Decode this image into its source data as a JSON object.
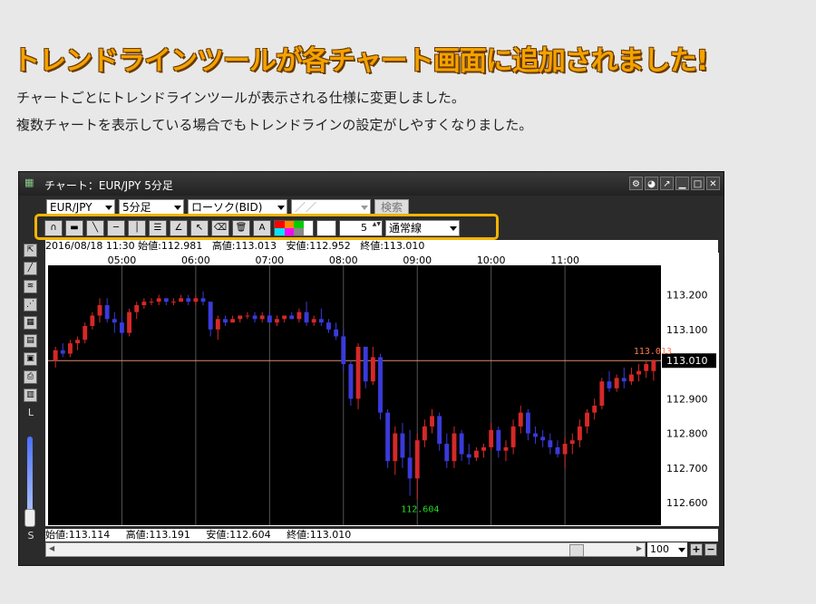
{
  "headline": "トレンドラインツールが各チャート画面に追加されました!",
  "description": [
    "チャートごとにトレンドラインツールが表示される仕様に変更しました。",
    "複数チャートを表示している場合でもトレンドラインの設定がしやすくなりました。"
  ],
  "window": {
    "title": "チャート：EUR/JPY 5分足",
    "buttons": [
      "gear-icon",
      "palette-icon",
      "popout-icon",
      "minimize-icon",
      "maximize-icon",
      "close-icon"
    ]
  },
  "toolbar": {
    "pair": "EUR/JPY",
    "timeframe": "5分足",
    "chart_type": "ローソク(BID)",
    "date_value": "／／",
    "search_label": "検索"
  },
  "trend_tools": {
    "line_width": "5",
    "line_style": "通常線",
    "palette_colors": [
      "#ff0000",
      "#ff8800",
      "#00cc00",
      "#ffffff",
      "#00e5ff",
      "#ff00ff",
      "#888888",
      "#ffffff"
    ]
  },
  "info_top": {
    "datetime": "2016/08/18 11:30",
    "open": "始値:112.981",
    "high": "高値:113.013",
    "low": "安値:112.952",
    "close": "終値:113.010"
  },
  "info_bottom": {
    "open": "始値:113.114",
    "high": "高値:113.191",
    "low": "安値:112.604",
    "close": "終値:113.010"
  },
  "side_tools": [
    "cursor-icon",
    "trendline-icon",
    "fib-icon",
    "channel-icon",
    "table-icon",
    "grid-icon",
    "note-icon",
    "print-icon",
    "save-icon"
  ],
  "zoom_labels": {
    "top": "L",
    "bottom": "S"
  },
  "zoom_value": "100",
  "chart_data": {
    "type": "candlestick",
    "xlabels": [
      "05:00",
      "06:00",
      "07:00",
      "08:00",
      "09:00",
      "10:00",
      "11:00"
    ],
    "ylabels": [
      "113.200",
      "113.100",
      "112.900",
      "112.800",
      "112.700",
      "112.600"
    ],
    "yticks": [
      113.2,
      113.1,
      112.9,
      112.8,
      112.7,
      112.6
    ],
    "ylim": [
      112.535,
      113.285
    ],
    "current_price": "113.010",
    "current_value": 113.01,
    "high_marker": "113.013",
    "low_marker": "112.604",
    "colors": {
      "up": "#d62828",
      "down": "#3a3adb",
      "bg": "#000000",
      "grid": "#555555",
      "price_line": "#e08a6a",
      "high_text": "#ff7a50",
      "low_text": "#22dd22"
    },
    "candles": [
      [
        113.01,
        113.05,
        112.99,
        113.04
      ],
      [
        113.04,
        113.06,
        113.02,
        113.03
      ],
      [
        113.03,
        113.07,
        113.02,
        113.06
      ],
      [
        113.06,
        113.08,
        113.04,
        113.07
      ],
      [
        113.07,
        113.12,
        113.06,
        113.11
      ],
      [
        113.11,
        113.15,
        113.1,
        113.14
      ],
      [
        113.14,
        113.19,
        113.12,
        113.17
      ],
      [
        113.17,
        113.19,
        113.12,
        113.13
      ],
      [
        113.13,
        113.15,
        113.09,
        113.12
      ],
      [
        113.12,
        113.14,
        113.08,
        113.09
      ],
      [
        113.09,
        113.16,
        113.08,
        113.15
      ],
      [
        113.15,
        113.18,
        113.13,
        113.17
      ],
      [
        113.17,
        113.19,
        113.16,
        113.18
      ],
      [
        113.18,
        113.19,
        113.17,
        113.18
      ],
      [
        113.18,
        113.2,
        113.17,
        113.19
      ],
      [
        113.19,
        113.19,
        113.17,
        113.18
      ],
      [
        113.18,
        113.19,
        113.17,
        113.18
      ],
      [
        113.18,
        113.2,
        113.18,
        113.19
      ],
      [
        113.19,
        113.2,
        113.17,
        113.18
      ],
      [
        113.18,
        113.2,
        113.17,
        113.19
      ],
      [
        113.19,
        113.21,
        113.17,
        113.18
      ],
      [
        113.18,
        113.18,
        113.08,
        113.1
      ],
      [
        113.1,
        113.14,
        113.07,
        113.13
      ],
      [
        113.13,
        113.14,
        113.11,
        113.12
      ],
      [
        113.12,
        113.14,
        113.12,
        113.13
      ],
      [
        113.13,
        113.14,
        113.12,
        113.14
      ],
      [
        113.14,
        113.15,
        113.13,
        113.14
      ],
      [
        113.14,
        113.15,
        113.12,
        113.13
      ],
      [
        113.13,
        113.15,
        113.12,
        113.14
      ],
      [
        113.14,
        113.15,
        113.12,
        113.12
      ],
      [
        113.12,
        113.14,
        113.11,
        113.13
      ],
      [
        113.13,
        113.14,
        113.12,
        113.14
      ],
      [
        113.14,
        113.15,
        113.13,
        113.13
      ],
      [
        113.13,
        113.16,
        113.12,
        113.15
      ],
      [
        113.15,
        113.18,
        113.11,
        113.12
      ],
      [
        113.12,
        113.14,
        113.11,
        113.13
      ],
      [
        113.13,
        113.16,
        113.11,
        113.12
      ],
      [
        113.12,
        113.13,
        113.09,
        113.1
      ],
      [
        113.1,
        113.12,
        113.07,
        113.08
      ],
      [
        113.08,
        113.1,
        112.98,
        113.0
      ],
      [
        113.0,
        113.01,
        112.88,
        112.9
      ],
      [
        112.9,
        113.06,
        112.87,
        113.05
      ],
      [
        113.05,
        113.05,
        112.93,
        112.95
      ],
      [
        112.95,
        113.05,
        112.94,
        113.02
      ],
      [
        113.02,
        113.03,
        112.84,
        112.86
      ],
      [
        112.86,
        112.87,
        112.7,
        112.72
      ],
      [
        112.72,
        112.82,
        112.68,
        112.8
      ],
      [
        112.8,
        112.83,
        112.7,
        112.73
      ],
      [
        112.73,
        112.81,
        112.62,
        112.67
      ],
      [
        112.67,
        112.8,
        112.61,
        112.78
      ],
      [
        112.78,
        112.84,
        112.76,
        112.82
      ],
      [
        112.82,
        112.87,
        112.8,
        112.85
      ],
      [
        112.85,
        112.86,
        112.75,
        112.77
      ],
      [
        112.77,
        112.8,
        112.7,
        112.72
      ],
      [
        112.72,
        112.82,
        112.7,
        112.8
      ],
      [
        112.8,
        112.81,
        112.72,
        112.74
      ],
      [
        112.74,
        112.77,
        112.71,
        112.73
      ],
      [
        112.73,
        112.76,
        112.72,
        112.75
      ],
      [
        112.75,
        112.77,
        112.73,
        112.76
      ],
      [
        112.76,
        112.83,
        112.75,
        112.81
      ],
      [
        112.81,
        112.82,
        112.73,
        112.75
      ],
      [
        112.75,
        112.78,
        112.72,
        112.76
      ],
      [
        112.76,
        112.84,
        112.74,
        112.82
      ],
      [
        112.82,
        112.88,
        112.8,
        112.86
      ],
      [
        112.86,
        112.87,
        112.78,
        112.8
      ],
      [
        112.8,
        112.82,
        112.77,
        112.79
      ],
      [
        112.79,
        112.81,
        112.76,
        112.78
      ],
      [
        112.78,
        112.8,
        112.74,
        112.76
      ],
      [
        112.76,
        112.78,
        112.73,
        112.74
      ],
      [
        112.74,
        112.79,
        112.7,
        112.77
      ],
      [
        112.77,
        112.8,
        112.74,
        112.78
      ],
      [
        112.78,
        112.84,
        112.76,
        112.82
      ],
      [
        112.82,
        112.87,
        112.8,
        112.86
      ],
      [
        112.86,
        112.9,
        112.84,
        112.88
      ],
      [
        112.88,
        112.96,
        112.87,
        112.95
      ],
      [
        112.95,
        112.98,
        112.92,
        112.93
      ],
      [
        112.93,
        112.97,
        112.92,
        112.96
      ],
      [
        112.96,
        112.99,
        112.93,
        112.95
      ],
      [
        112.95,
        112.99,
        112.94,
        112.97
      ],
      [
        112.97,
        113.0,
        112.95,
        112.98
      ],
      [
        112.98,
        113.01,
        112.96,
        113.0
      ],
      [
        112.98,
        113.013,
        112.952,
        113.01
      ]
    ]
  }
}
